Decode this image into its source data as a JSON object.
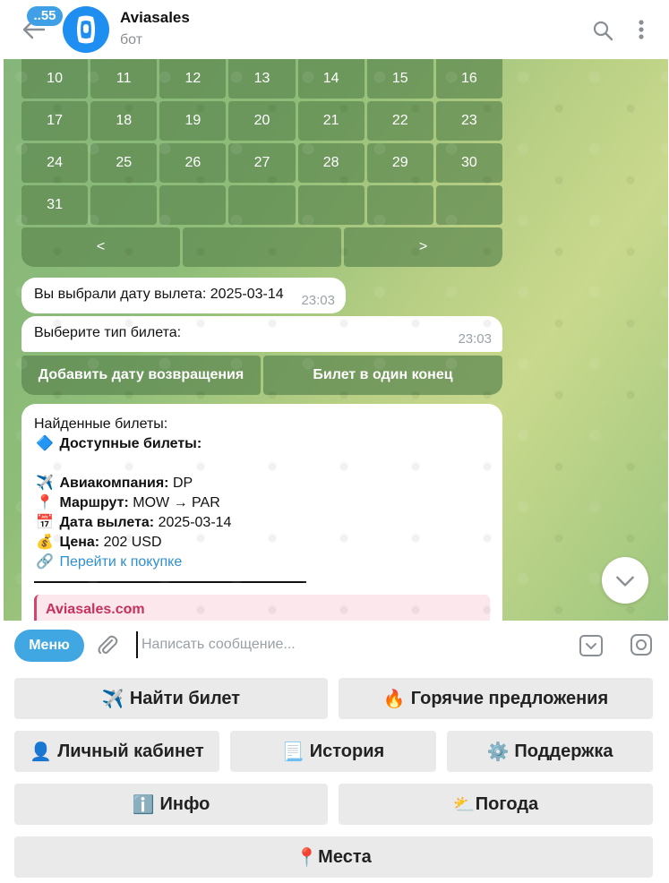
{
  "header": {
    "badge": "..55",
    "title": "Aviasales",
    "subtitle": "бот"
  },
  "calendar": {
    "rows": [
      [
        "10",
        "11",
        "12",
        "13",
        "14",
        "15",
        "16"
      ],
      [
        "17",
        "18",
        "19",
        "20",
        "21",
        "22",
        "23"
      ],
      [
        "24",
        "25",
        "26",
        "27",
        "28",
        "29",
        "30"
      ],
      [
        "31",
        "",
        "",
        "",
        "",
        "",
        ""
      ]
    ],
    "prev": "<",
    "middle": "",
    "next": ">"
  },
  "messages": [
    {
      "text": "Вы выбрали дату вылета: 2025-03-14",
      "time": "23:03"
    },
    {
      "text": "Выберите тип билета:",
      "time": "23:03"
    }
  ],
  "ticket_type_buttons": [
    "Добавить дату возвращения",
    "Билет в один конец"
  ],
  "result": {
    "intro": "Найденные билеты:",
    "available_label": "Доступные билеты:",
    "airline_label": "Авиакомпания:",
    "airline_value": "DP",
    "route_label": "Маршрут:",
    "route_value": "MOW → PAR",
    "date_label": "Дата вылета:",
    "date_value": "2025-03-14",
    "price_label": "Цена:",
    "price_value": "202 USD",
    "link_text": "Перейти к покупке",
    "preview_site": "Aviasales.com",
    "emoji": {
      "diamond": "🔷",
      "plane": "✈️",
      "pin": "📍",
      "calendar": "📅",
      "money": "💰",
      "link": "🔗"
    }
  },
  "composer": {
    "menu_label": "Меню",
    "placeholder": "Написать сообщение..."
  },
  "reply_keyboard": {
    "find_emoji": "✈️",
    "find_label": "Найти билет",
    "hot_emoji": "🔥",
    "hot_label": "Горячие предложения",
    "cabinet_emoji": "👤",
    "cabinet_label": "Личный кабинет",
    "history_emoji": "📃",
    "history_label": "История",
    "support_emoji": "⚙️",
    "support_label": "Поддержка",
    "info_emoji": "ℹ️",
    "info_label": "Инфо",
    "weather_emoji": "⛅",
    "weather_label": "Погода",
    "places_emoji": "📍",
    "places_label": "Места"
  },
  "colors": {
    "accent": "#40a7e3",
    "badge": "#3fa0e6",
    "avatar": "#1e8ff0",
    "link": "#2f8fd1",
    "preview_accent": "#d1466a"
  }
}
